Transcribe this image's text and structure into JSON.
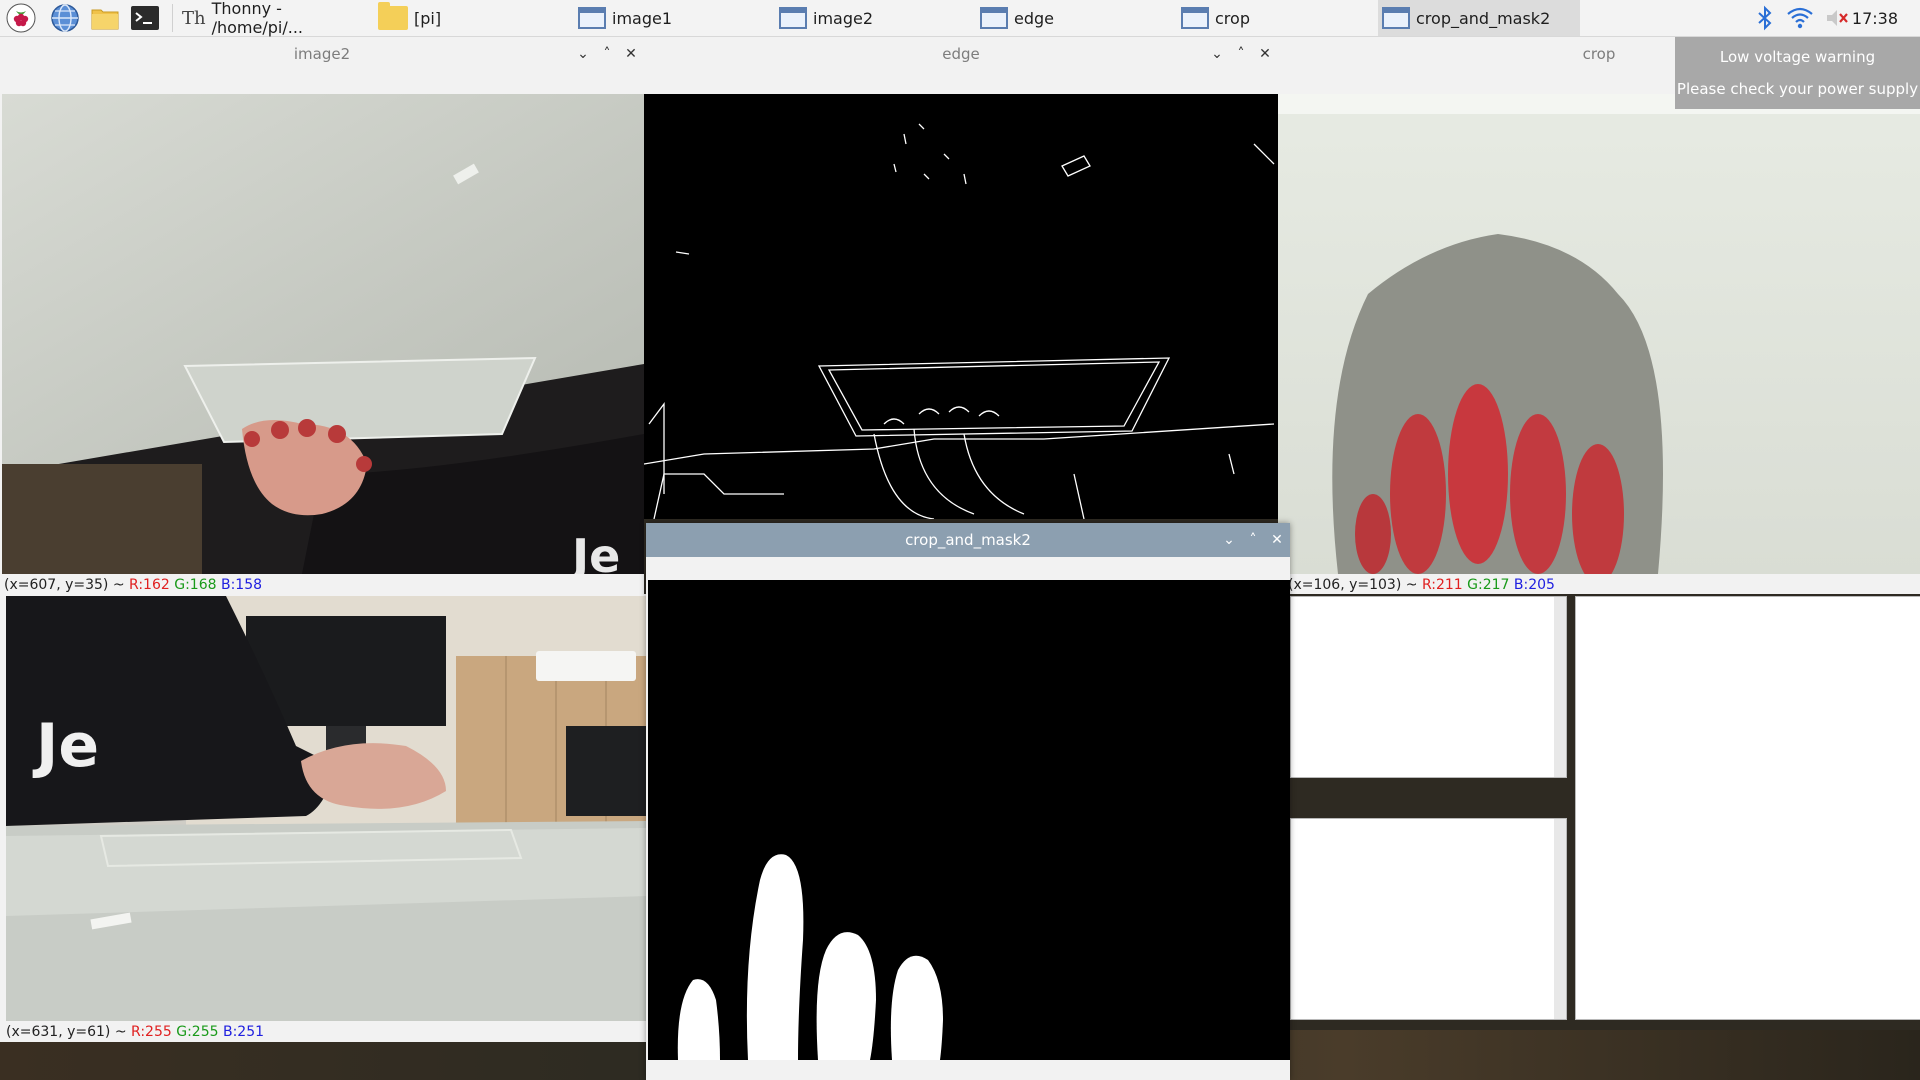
{
  "taskbar": {
    "apps": [
      {
        "label": "Thonny  -  /home/pi/..."
      },
      {
        "label": "[pi]"
      },
      {
        "label": "image1"
      },
      {
        "label": "image2"
      },
      {
        "label": "edge"
      },
      {
        "label": "crop"
      },
      {
        "label": "crop_and_mask2"
      }
    ],
    "clock": "17:38"
  },
  "notification": {
    "title": "Low voltage warning",
    "message": "Please check your power supply"
  },
  "windows": {
    "image2": {
      "title": "image2",
      "pixel_info": {
        "coords": "(x=607, y=35) ~ ",
        "r": "R:162",
        "g": "G:168",
        "b": "B:158"
      }
    },
    "edge": {
      "title": "edge"
    },
    "crop": {
      "title": "crop",
      "pixel_info": {
        "coords": "(x=106, y=103) ~ ",
        "r": "R:211",
        "g": "G:217",
        "b": "B:205"
      }
    },
    "image1": {
      "pixel_info": {
        "coords": "(x=631, y=61) ~ ",
        "r": "R:255",
        "g": "G:255",
        "b": "B:251"
      }
    },
    "crop_and_mask2": {
      "title": "crop_and_mask2"
    }
  }
}
